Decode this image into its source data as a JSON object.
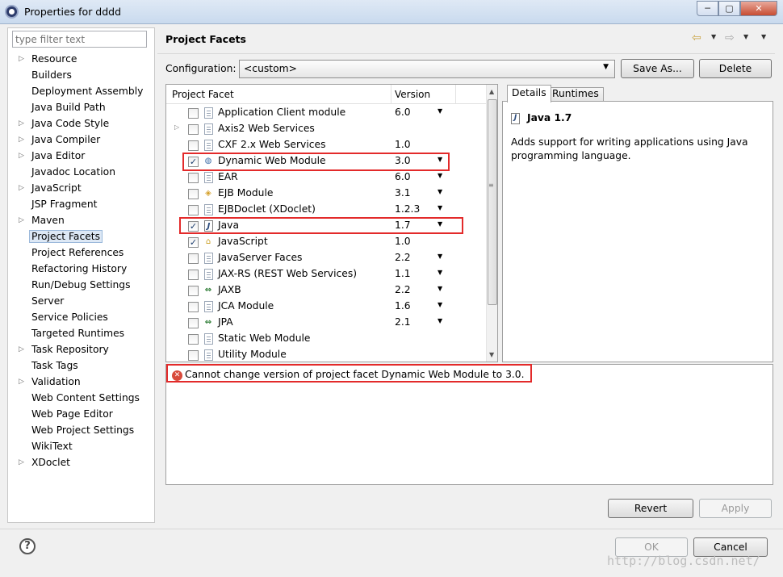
{
  "window": {
    "title": "Properties for dddd",
    "minimize": "─",
    "maximize": "▢",
    "close": "✕"
  },
  "sidebar": {
    "filter_placeholder": "type filter text",
    "items": [
      {
        "label": "Resource",
        "expandable": true
      },
      {
        "label": "Builders",
        "expandable": false
      },
      {
        "label": "Deployment Assembly",
        "expandable": false
      },
      {
        "label": "Java Build Path",
        "expandable": false
      },
      {
        "label": "Java Code Style",
        "expandable": true
      },
      {
        "label": "Java Compiler",
        "expandable": true
      },
      {
        "label": "Java Editor",
        "expandable": true
      },
      {
        "label": "Javadoc Location",
        "expandable": false
      },
      {
        "label": "JavaScript",
        "expandable": true
      },
      {
        "label": "JSP Fragment",
        "expandable": false
      },
      {
        "label": "Maven",
        "expandable": true
      },
      {
        "label": "Project Facets",
        "expandable": false,
        "selected": true
      },
      {
        "label": "Project References",
        "expandable": false
      },
      {
        "label": "Refactoring History",
        "expandable": false
      },
      {
        "label": "Run/Debug Settings",
        "expandable": false
      },
      {
        "label": "Server",
        "expandable": false
      },
      {
        "label": "Service Policies",
        "expandable": false
      },
      {
        "label": "Targeted Runtimes",
        "expandable": false
      },
      {
        "label": "Task Repository",
        "expandable": true
      },
      {
        "label": "Task Tags",
        "expandable": false
      },
      {
        "label": "Validation",
        "expandable": true
      },
      {
        "label": "Web Content Settings",
        "expandable": false
      },
      {
        "label": "Web Page Editor",
        "expandable": false
      },
      {
        "label": "Web Project Settings",
        "expandable": false
      },
      {
        "label": "WikiText",
        "expandable": false
      },
      {
        "label": "XDoclet",
        "expandable": true
      }
    ]
  },
  "page": {
    "title": "Project Facets",
    "configuration_label": "Configuration:",
    "configuration_value": "<custom>",
    "save_as": "Save As...",
    "delete": "Delete"
  },
  "facets": {
    "col_facet": "Project Facet",
    "col_version": "Version",
    "rows": [
      {
        "name": "Application Client module",
        "version": "6.0",
        "checked": false,
        "dropdown": true,
        "icon": "doc",
        "expandable": false
      },
      {
        "name": "Axis2 Web Services",
        "version": "",
        "checked": false,
        "dropdown": false,
        "icon": "doc",
        "expandable": true
      },
      {
        "name": "CXF 2.x Web Services",
        "version": "1.0",
        "checked": false,
        "dropdown": false,
        "icon": "doc",
        "expandable": false
      },
      {
        "name": "Dynamic Web Module",
        "version": "3.0",
        "checked": true,
        "dropdown": true,
        "icon": "web",
        "expandable": false
      },
      {
        "name": "EAR",
        "version": "6.0",
        "checked": false,
        "dropdown": true,
        "icon": "doc",
        "expandable": false
      },
      {
        "name": "EJB Module",
        "version": "3.1",
        "checked": false,
        "dropdown": true,
        "icon": "ejb",
        "expandable": false
      },
      {
        "name": "EJBDoclet (XDoclet)",
        "version": "1.2.3",
        "checked": false,
        "dropdown": true,
        "icon": "doc",
        "expandable": false
      },
      {
        "name": "Java",
        "version": "1.7",
        "checked": true,
        "dropdown": true,
        "icon": "java",
        "expandable": false
      },
      {
        "name": "JavaScript",
        "version": "1.0",
        "checked": true,
        "dropdown": false,
        "icon": "js",
        "expandable": false
      },
      {
        "name": "JavaServer Faces",
        "version": "2.2",
        "checked": false,
        "dropdown": true,
        "icon": "doc",
        "expandable": false
      },
      {
        "name": "JAX-RS (REST Web Services)",
        "version": "1.1",
        "checked": false,
        "dropdown": true,
        "icon": "doc",
        "expandable": false
      },
      {
        "name": "JAXB",
        "version": "2.2",
        "checked": false,
        "dropdown": true,
        "icon": "arrows",
        "expandable": false
      },
      {
        "name": "JCA Module",
        "version": "1.6",
        "checked": false,
        "dropdown": true,
        "icon": "doc",
        "expandable": false
      },
      {
        "name": "JPA",
        "version": "2.1",
        "checked": false,
        "dropdown": true,
        "icon": "arrows",
        "expandable": false
      },
      {
        "name": "Static Web Module",
        "version": "",
        "checked": false,
        "dropdown": false,
        "icon": "doc",
        "expandable": false
      },
      {
        "name": "Utility Module",
        "version": "",
        "checked": false,
        "dropdown": false,
        "icon": "doc",
        "expandable": false
      }
    ]
  },
  "details": {
    "tab_details": "Details",
    "tab_runtimes": "Runtimes",
    "title": "Java 1.7",
    "description": "Adds support for writing applications using Java programming language."
  },
  "message": {
    "error": "Cannot change version of project facet Dynamic Web Module to 3.0."
  },
  "buttons": {
    "revert": "Revert",
    "apply": "Apply",
    "ok": "OK",
    "cancel": "Cancel",
    "help": "?"
  },
  "watermark": "http://blog.csdn.net/",
  "colors": {
    "highlight_border": "#e32a2a",
    "error_icon": "#d84a3b",
    "selection_bg": "#dde8f5"
  }
}
